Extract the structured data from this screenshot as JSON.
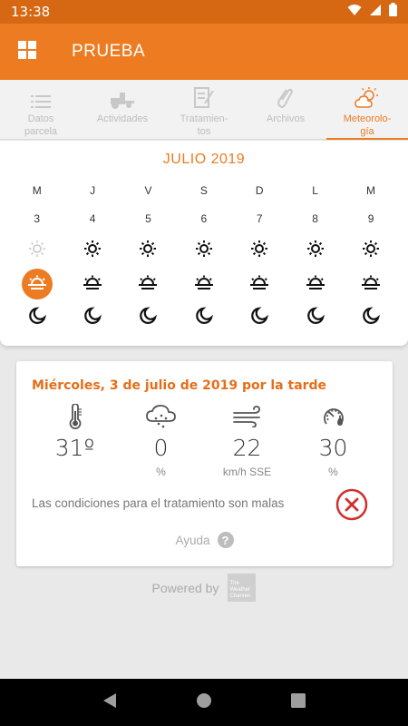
{
  "status": {
    "time": "13:38"
  },
  "app": {
    "title": "PRUEBA"
  },
  "tabs": [
    {
      "label": "Datos parcela",
      "icon": "list-icon"
    },
    {
      "label": "Actividades",
      "icon": "tractor-icon"
    },
    {
      "label": "Tratamien-tos",
      "icon": "document-edit-icon"
    },
    {
      "label": "Archivos",
      "icon": "paperclip-icon"
    },
    {
      "label": "Meteorolo-gía",
      "icon": "cloud-sun-icon",
      "active": true
    }
  ],
  "calendar": {
    "month": "JULIO 2019",
    "days": [
      {
        "dow": "M",
        "num": "3"
      },
      {
        "dow": "J",
        "num": "4"
      },
      {
        "dow": "V",
        "num": "5"
      },
      {
        "dow": "S",
        "num": "6"
      },
      {
        "dow": "D",
        "num": "7"
      },
      {
        "dow": "L",
        "num": "8"
      },
      {
        "dow": "M",
        "num": "9"
      }
    ],
    "selected_day_index": 0,
    "selected_period": "afternoon"
  },
  "detail": {
    "title": "Miércoles, 3 de julio de 2019 por la tarde",
    "metrics": [
      {
        "icon": "thermometer-icon",
        "value": "31º",
        "unit": ""
      },
      {
        "icon": "rain-cloud-icon",
        "value": "0",
        "unit": "%"
      },
      {
        "icon": "wind-icon",
        "value": "22",
        "unit": "km/h SSE"
      },
      {
        "icon": "humidity-gauge-icon",
        "value": "30",
        "unit": "%"
      }
    ],
    "condition": "Las condiciones para el tratamiento son malas",
    "condition_status": "bad",
    "help_label": "Ayuda"
  },
  "footer": {
    "powered_by": "Powered by",
    "brand": "The Weather Channel"
  },
  "colors": {
    "accent": "#ec7b22",
    "danger": "#d32f2f"
  }
}
